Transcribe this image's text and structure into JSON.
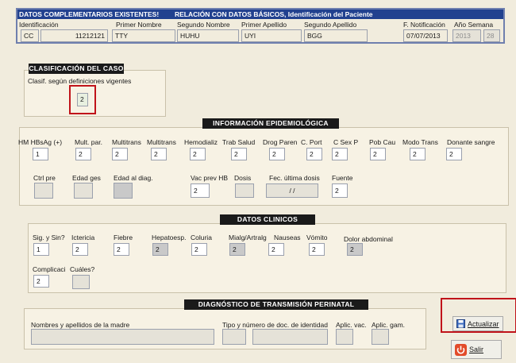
{
  "header": {
    "left_title": "DATOS COMPLEMENTARIOS EXISTENTES!",
    "right_title": "RELACIÓN CON DATOS BÁSICOS,  Identificación del Paciente",
    "labels": {
      "identificacion": "Identificación",
      "primer_nombre": "Primer Nombre",
      "segundo_nombre": "Segundo Nombre",
      "primer_apellido": "Primer Apellido",
      "segundo_apellido": "Segundo Apellido",
      "f_notificacion": "F. Notificación",
      "anio_semana": "Año Semana"
    },
    "values": {
      "id_type": "CC",
      "id_number": "11212121",
      "primer_nombre": "TTY",
      "segundo_nombre": "HUHU",
      "primer_apellido": "UYI",
      "segundo_apellido": "BGG",
      "f_notificacion": "07/07/2013",
      "anio": "2013",
      "semana": "28"
    }
  },
  "clasificacion": {
    "title": "CLASIFICACIÓN DEL CASO",
    "label": "Clasif. según definiciones vigentes",
    "value": "2"
  },
  "info_epi": {
    "title": "INFORMACIÓN EPIDEMIOLÓGICA",
    "row1": [
      {
        "label": "HM HBsAg (+)",
        "value": "1"
      },
      {
        "label": "Mult. par.",
        "value": "2"
      },
      {
        "label": "Multitrans",
        "value": "2"
      },
      {
        "label": "Multitrans",
        "value": "2"
      },
      {
        "label": "Hemodializ",
        "value": "2"
      },
      {
        "label": "Trab Salud",
        "value": "2"
      },
      {
        "label": "Drog Paren",
        "value": "2"
      },
      {
        "label": "C. Port",
        "value": "2"
      },
      {
        "label": "C Sex P",
        "value": "2"
      },
      {
        "label": "Pob Cau",
        "value": "2"
      },
      {
        "label": "Modo Trans",
        "value": "2"
      },
      {
        "label": "Donante sangre",
        "value": "2"
      }
    ],
    "row2": [
      {
        "label": "Ctrl pre",
        "value": ""
      },
      {
        "label": "Edad ges",
        "value": ""
      },
      {
        "label": "Edad al diag.",
        "value": ""
      },
      {
        "label": "Vac prev HB",
        "value": "2"
      },
      {
        "label": "Dosis",
        "value": ""
      },
      {
        "label": "Fec. última dosis",
        "value": "/ /"
      },
      {
        "label": "Fuente",
        "value": "2"
      }
    ]
  },
  "clinicos": {
    "title": "DATOS CLINICOS",
    "row1": [
      {
        "label": "Sig. y Sin?",
        "value": "1"
      },
      {
        "label": "Ictericia",
        "value": "2"
      },
      {
        "label": "Fiebre",
        "value": "2"
      },
      {
        "label": "Hepatoesp.",
        "value": "2"
      },
      {
        "label": "Coluria",
        "value": "2"
      },
      {
        "label": "Mialg/Artralg",
        "value": "2"
      },
      {
        "label": "Nauseas",
        "value": "2"
      },
      {
        "label": "Vómito",
        "value": "2"
      },
      {
        "label": "Dolor abdominal",
        "value": "2"
      }
    ],
    "row2": [
      {
        "label": "Complicaci",
        "value": "2"
      },
      {
        "label": "Cuáles?",
        "value": ""
      }
    ]
  },
  "perinatal": {
    "title": "DIAGNÓSTICO DE TRANSMISIÓN PERINATAL",
    "labels": {
      "madre": "Nombres y apellidos de la madre",
      "tipo_doc": "Tipo y número de doc. de identidad",
      "aplic_vac": "Aplic. vac.",
      "aplic_gam": "Aplic. gam."
    }
  },
  "buttons": {
    "actualizar": "Actualizar",
    "salir": "Salir"
  },
  "colors": {
    "header_bg": "#21418f",
    "section_bg": "#1a1a1a",
    "highlight": "#c0131a"
  }
}
